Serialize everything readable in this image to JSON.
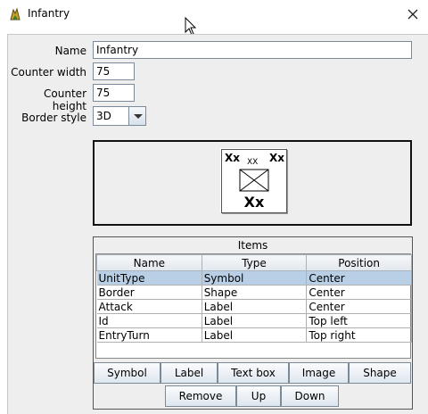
{
  "window": {
    "title": "Infantry"
  },
  "form": {
    "name_label": "Name",
    "name_value": "Infantry",
    "counter_width_label": "Counter width",
    "counter_width_value": "75",
    "counter_height_label": "Counter height",
    "counter_height_value": "75",
    "border_style_label": "Border style",
    "border_style_value": "3D"
  },
  "preview": {
    "top_left": "Xx",
    "top_right": "Xx",
    "center_small": "XX",
    "bottom": "Xx"
  },
  "items": {
    "title": "Items",
    "columns": [
      "Name",
      "Type",
      "Position"
    ],
    "rows": [
      {
        "name": "UnitType",
        "type": "Symbol",
        "position": "Center"
      },
      {
        "name": "Border",
        "type": "Shape",
        "position": "Center"
      },
      {
        "name": "Attack",
        "type": "Label",
        "position": "Center"
      },
      {
        "name": "Id",
        "type": "Label",
        "position": "Top left"
      },
      {
        "name": "EntryTurn",
        "type": "Label",
        "position": "Top right"
      }
    ]
  },
  "buttons": {
    "symbol": "Symbol",
    "label": "Label",
    "text_box": "Text box",
    "image": "Image",
    "shape": "Shape",
    "remove": "Remove",
    "up": "Up",
    "down": "Down"
  }
}
